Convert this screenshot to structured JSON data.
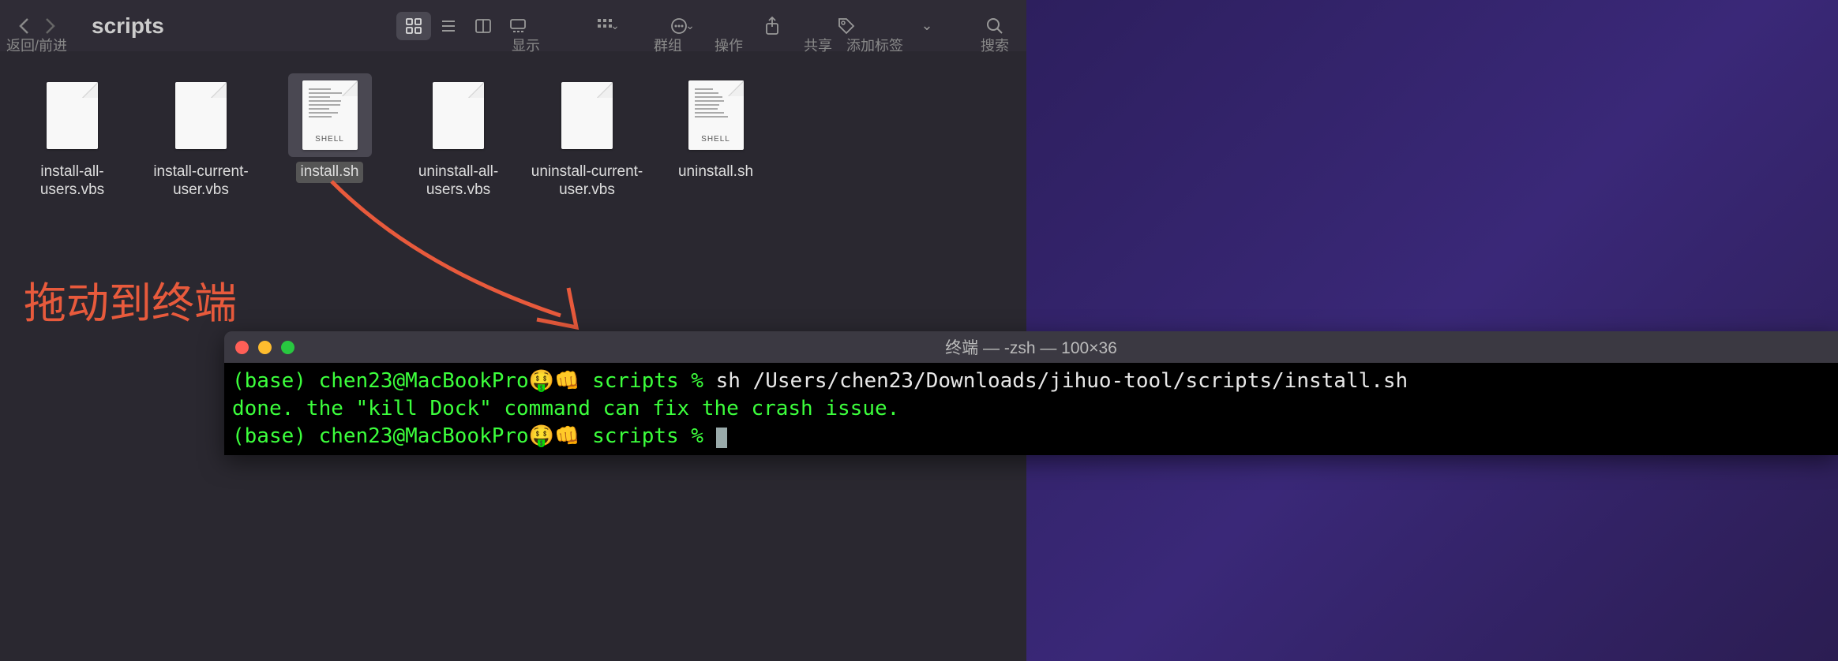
{
  "finder": {
    "title": "scripts",
    "nav_label": "返回/前进",
    "toolbar_labels": {
      "view": "显示",
      "group": "群组",
      "action": "操作",
      "share": "共享",
      "tag": "添加标签",
      "search": "搜索"
    },
    "files": [
      {
        "name": "install-all-users.vbs",
        "type": "plain",
        "selected": false
      },
      {
        "name": "install-current-user.vbs",
        "type": "plain",
        "selected": false
      },
      {
        "name": "install.sh",
        "type": "shell",
        "selected": true,
        "tag": "SHELL"
      },
      {
        "name": "uninstall-all-users.vbs",
        "type": "plain",
        "selected": false
      },
      {
        "name": "uninstall-current-user.vbs",
        "type": "plain",
        "selected": false
      },
      {
        "name": "uninstall.sh",
        "type": "shell",
        "selected": false,
        "tag": "SHELL"
      }
    ]
  },
  "annotation": {
    "text": "拖动到终端",
    "arrow_color": "#e85a3c"
  },
  "terminal": {
    "title": "终端 — -zsh — 100×36",
    "lines": [
      {
        "prompt": "(base) chen23@MacBookPro🤑👊 scripts %",
        "cmd": " sh /Users/chen23/Downloads/jihuo-tool/scripts/install.sh"
      },
      {
        "text": "done. the \"kill Dock\" command can fix the crash issue."
      },
      {
        "prompt": "(base) chen23@MacBookPro🤑👊 scripts %",
        "cmd": " ",
        "cursor": true
      }
    ]
  }
}
